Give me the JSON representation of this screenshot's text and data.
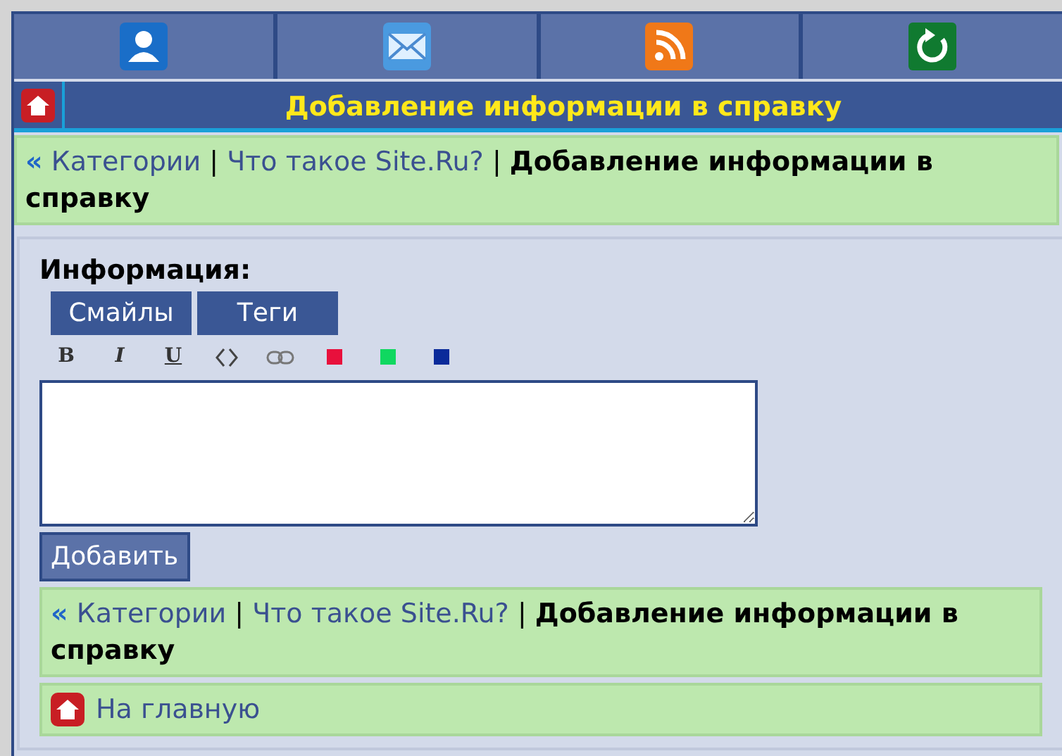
{
  "top_icons": [
    {
      "kind": "user"
    },
    {
      "kind": "mail"
    },
    {
      "kind": "rss"
    },
    {
      "kind": "refresh"
    }
  ],
  "header": {
    "title": "Добавление информации в справку"
  },
  "breadcrumb_top": {
    "back": "«",
    "items": [
      {
        "kind": "link",
        "text": "Категории"
      },
      {
        "kind": "sep",
        "text": "|"
      },
      {
        "kind": "link",
        "text": "Что такое Site.Ru?"
      },
      {
        "kind": "sep",
        "text": "|"
      },
      {
        "kind": "current",
        "text": "Добавление информации в справку"
      }
    ]
  },
  "form": {
    "label": "Информация:",
    "tabs": [
      {
        "label": "Смайлы"
      },
      {
        "label": "Теги"
      }
    ],
    "toolbar": [
      {
        "kind": "bold",
        "text": "B"
      },
      {
        "kind": "italic",
        "text": "I"
      },
      {
        "kind": "underline",
        "text": "U"
      },
      {
        "kind": "code"
      },
      {
        "kind": "link"
      },
      {
        "kind": "color",
        "color": "#e8103c"
      },
      {
        "kind": "color",
        "color": "#10d860"
      },
      {
        "kind": "color",
        "color": "#0a2a9a"
      }
    ],
    "submit": "Добавить"
  },
  "breadcrumb_bottom": {
    "back": "«",
    "items": [
      {
        "kind": "link",
        "text": "Категории"
      },
      {
        "kind": "sep",
        "text": "|"
      },
      {
        "kind": "link",
        "text": "Что такое Site.Ru?"
      },
      {
        "kind": "sep",
        "text": "|"
      },
      {
        "kind": "current",
        "text": "Добавление информации в справку"
      }
    ]
  },
  "home_link": {
    "text": "На главную"
  }
}
